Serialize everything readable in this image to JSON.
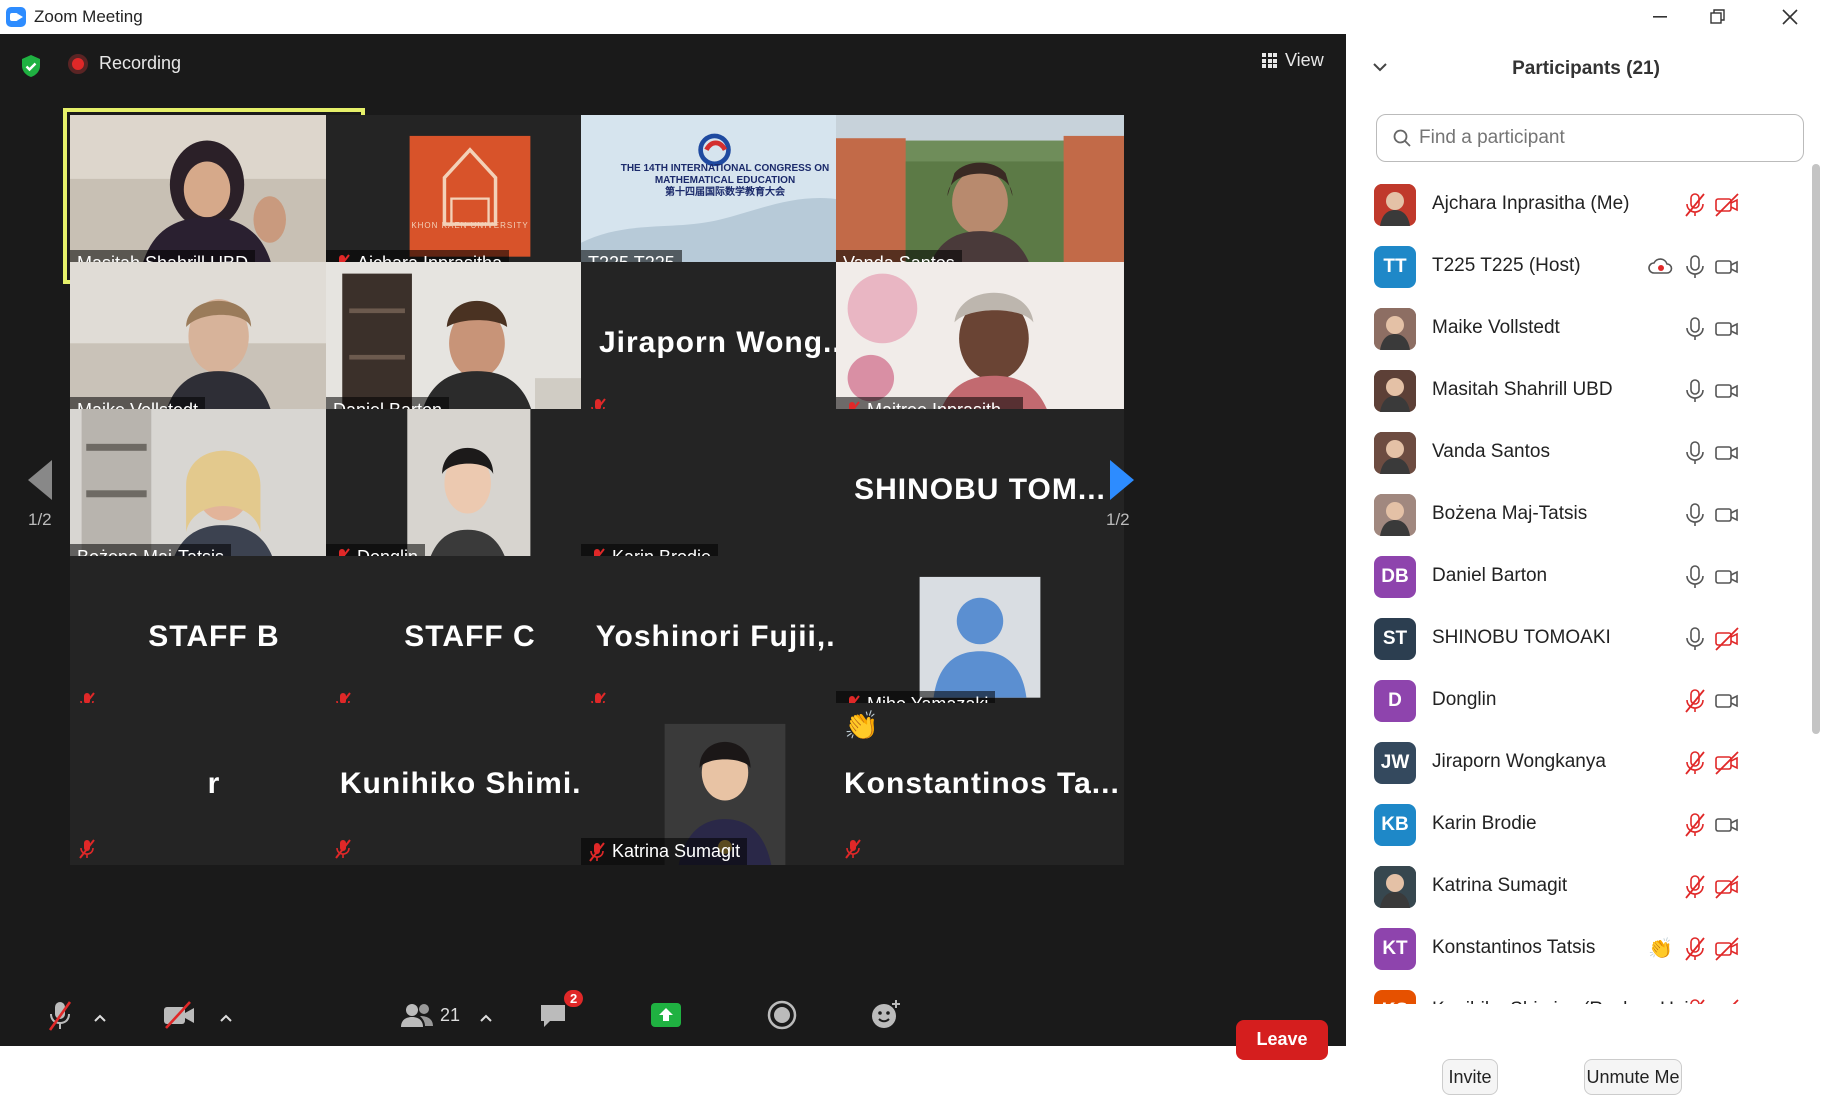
{
  "window": {
    "title": "Zoom Meeting"
  },
  "meeting": {
    "recording_label": "Recording",
    "view_label": "View",
    "page_indicator_left": "1/2",
    "page_indicator_right": "1/2"
  },
  "tiles": [
    {
      "name": "Masitah Shahrill UBD",
      "display": "",
      "muted": false,
      "type": "video"
    },
    {
      "name": "Ajchara Inprasitha",
      "display": "",
      "muted": true,
      "type": "logo"
    },
    {
      "name": "T225 T225",
      "display": "",
      "muted": false,
      "type": "slide"
    },
    {
      "name": "Vanda Santos",
      "display": "",
      "muted": false,
      "type": "video"
    },
    {
      "name": "Maike Vollstedt",
      "display": "",
      "muted": false,
      "type": "video"
    },
    {
      "name": "Daniel Barton",
      "display": "",
      "muted": false,
      "type": "video"
    },
    {
      "name": "",
      "display": "Jiraporn  Wong...",
      "muted": true,
      "type": "text"
    },
    {
      "name": "Maitree Inprasith...",
      "display": "",
      "muted": true,
      "type": "video"
    },
    {
      "name": "Bożena Maj-Tatsis",
      "display": "",
      "muted": false,
      "type": "video"
    },
    {
      "name": "Donglin",
      "display": "",
      "muted": true,
      "type": "video"
    },
    {
      "name": "Karin Brodie",
      "display": "",
      "muted": true,
      "type": "blank"
    },
    {
      "name": "",
      "display": "SHINOBU  TOM...",
      "muted": false,
      "type": "text"
    },
    {
      "name": "",
      "display": "STAFF  B",
      "muted": true,
      "type": "text"
    },
    {
      "name": "",
      "display": "STAFF  C",
      "muted": true,
      "type": "text"
    },
    {
      "name": "",
      "display": "Yoshinori  Fujii,...",
      "muted": true,
      "type": "text"
    },
    {
      "name": "Miho Yamazaki",
      "display": "",
      "muted": true,
      "type": "avatar"
    },
    {
      "name": "",
      "display": "r",
      "muted": true,
      "type": "text"
    },
    {
      "name": "",
      "display": "Kunihiko  Shimi...",
      "muted": true,
      "type": "text"
    },
    {
      "name": "Katrina Sumagit",
      "display": "",
      "muted": true,
      "type": "video"
    },
    {
      "name": "",
      "display": "Konstantinos  Ta...",
      "muted": true,
      "type": "text",
      "reaction": "👏"
    }
  ],
  "slide": {
    "line1": "THE 14TH INTERNATIONAL CONGRESS ON",
    "line2": "MATHEMATICAL EDUCATION",
    "line3": "第十四届国际数学教育大会"
  },
  "logo_caption": "KHON KAEN UNIVERSITY",
  "toolbar": {
    "participants_count": "21",
    "chat_badge": "2",
    "leave_label": "Leave"
  },
  "panel": {
    "title": "Participants (21)",
    "search_placeholder": "Find a participant",
    "invite_label": "Invite",
    "unmute_label": "Unmute Me",
    "participants": [
      {
        "name": "Ajchara Inprasitha (Me)",
        "initials": "",
        "color": "#c0392b",
        "mic": "muted",
        "video": "off",
        "extra": ""
      },
      {
        "name": "T225 T225 (Host)",
        "initials": "TT",
        "color": "#1e88c8",
        "mic": "on",
        "video": "on",
        "extra": "recording"
      },
      {
        "name": "Maike Vollstedt",
        "initials": "",
        "color": "#8d6e63",
        "mic": "on",
        "video": "on",
        "extra": ""
      },
      {
        "name": "Masitah Shahrill UBD",
        "initials": "",
        "color": "#5d4037",
        "mic": "on",
        "video": "on",
        "extra": ""
      },
      {
        "name": "Vanda Santos",
        "initials": "",
        "color": "#6d4c41",
        "mic": "on",
        "video": "on",
        "extra": ""
      },
      {
        "name": "Bożena Maj-Tatsis",
        "initials": "",
        "color": "#a1887f",
        "mic": "on",
        "video": "on",
        "extra": ""
      },
      {
        "name": "Daniel Barton",
        "initials": "DB",
        "color": "#8e44ad",
        "mic": "on",
        "video": "on",
        "extra": ""
      },
      {
        "name": "SHINOBU TOMOAKI",
        "initials": "ST",
        "color": "#2c3e50",
        "mic": "on",
        "video": "off",
        "extra": ""
      },
      {
        "name": "Donglin",
        "initials": "D",
        "color": "#8e44ad",
        "mic": "muted",
        "video": "on",
        "extra": ""
      },
      {
        "name": "Jiraporn Wongkanya",
        "initials": "JW",
        "color": "#34495e",
        "mic": "muted",
        "video": "off",
        "extra": ""
      },
      {
        "name": "Karin Brodie",
        "initials": "KB",
        "color": "#1e88c8",
        "mic": "muted",
        "video": "on",
        "extra": ""
      },
      {
        "name": "Katrina Sumagit",
        "initials": "",
        "color": "#37474f",
        "mic": "muted",
        "video": "off",
        "extra": ""
      },
      {
        "name": "Konstantinos Tatsis",
        "initials": "KT",
        "color": "#8e44ad",
        "mic": "muted",
        "video": "off",
        "extra": "clap"
      },
      {
        "name": "Kunihiko Shimizu (Reshun Univ...",
        "initials": "KS",
        "color": "#e65100",
        "mic": "muted",
        "video": "off",
        "extra": ""
      }
    ]
  },
  "colors": {
    "meeting_bg": "#1a1a1a",
    "tile_bg": "#242424",
    "active_speaker": "#e6f06a",
    "muted_red": "#e02828",
    "leave_red": "#d51e1e",
    "share_green": "#1fb141",
    "nav_blue": "#2d8cff"
  }
}
